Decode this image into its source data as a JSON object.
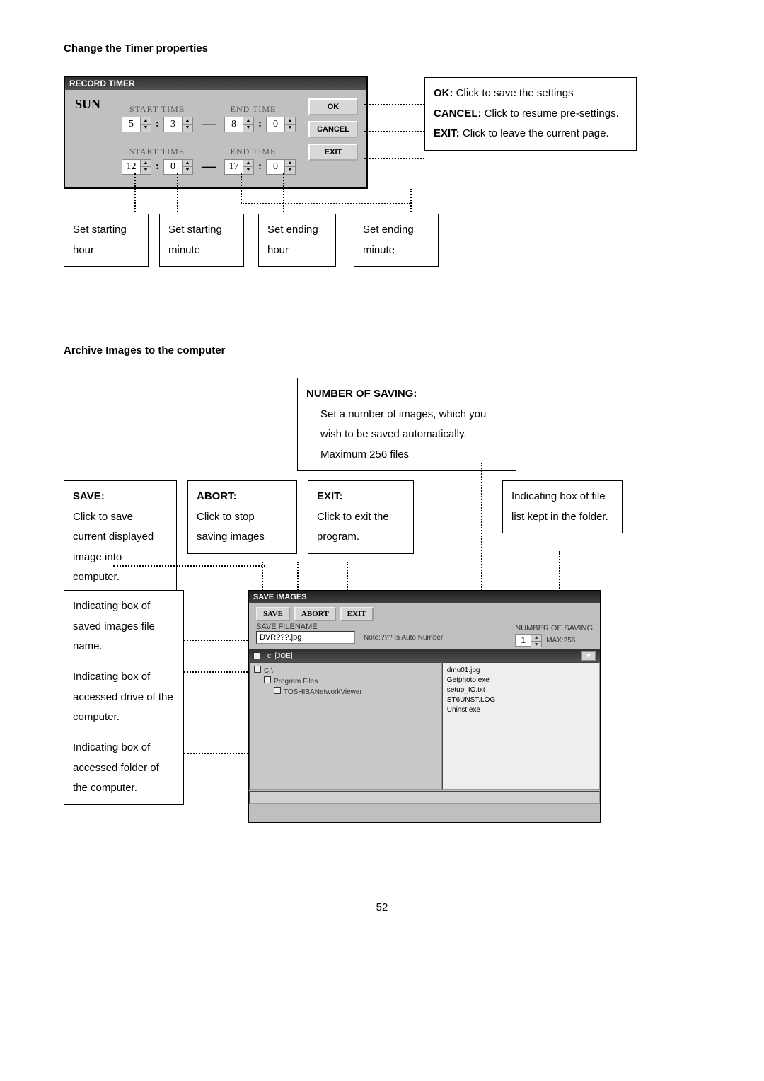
{
  "section1": {
    "heading": "Change the Timer properties",
    "dialog": {
      "title": "RECORD TIMER",
      "day": "SUN",
      "start_time_label": "START TIME",
      "end_time_label": "END TIME",
      "row1": {
        "start_h": "5",
        "start_m": "3",
        "end_h": "8",
        "end_m": "0"
      },
      "row2": {
        "start_h": "12",
        "start_m": "0",
        "end_h": "17",
        "end_m": "0"
      },
      "buttons": {
        "ok": "OK",
        "cancel": "CANCEL",
        "exit": "EXIT"
      }
    },
    "callout_right": {
      "ok_bold": "OK:",
      "ok_text": " Click to save the settings",
      "cancel_bold": "CANCEL:",
      "cancel_text": " Click to resume pre-settings.",
      "exit_bold": "EXIT:",
      "exit_text": " Click to leave the current page."
    },
    "callouts_bottom": [
      "Set starting hour",
      "Set starting minute",
      "Set ending hour",
      "Set ending minute"
    ]
  },
  "section2": {
    "heading": "Archive Images to the computer",
    "top_box": {
      "title": "NUMBER OF SAVING:",
      "text": "Set a number of images, which you wish to be saved automatically. Maximum 256 files"
    },
    "row_boxes": {
      "save_title": "SAVE:",
      "save_text": "Click to save current displayed image into computer.",
      "abort_title": "ABORT:",
      "abort_text": "Click to stop saving images",
      "exit_title": "EXIT:",
      "exit_text": "Click to exit the program.",
      "filelist_text": "Indicating box of file list kept in the folder."
    },
    "left_boxes": [
      "Indicating box of saved images file name.",
      "Indicating box of accessed drive of the computer.",
      "Indicating box of accessed folder of the computer."
    ],
    "dialog": {
      "title": "SAVE IMAGES",
      "buttons": {
        "save": "SAVE",
        "abort": "ABORT",
        "exit": "EXIT"
      },
      "filename_label": "SAVE FILENAME",
      "filename_value": "DVR???.jpg",
      "note": "Note:??? Is Auto Number",
      "numsave_label": "NUMBER OF SAVING",
      "numsave_value": "1",
      "numsave_max": "MAX:256",
      "drive": "c: [JOE]",
      "tree": [
        "C:\\",
        "Program Files",
        "TOSHIBANetworkViewer"
      ],
      "files": [
        "dmu01.jpg",
        "Getphoto.exe",
        "setup_IO.txt",
        "ST6UNST.LOG",
        "Uninst.exe"
      ]
    }
  },
  "page_number": "52"
}
